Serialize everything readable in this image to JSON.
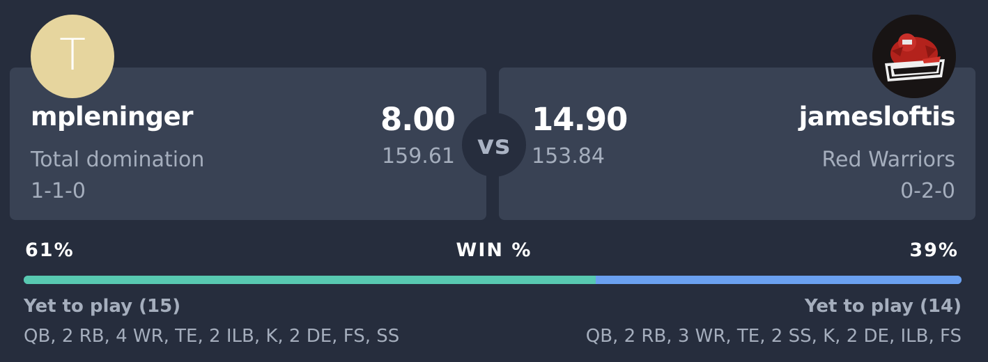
{
  "matchup": {
    "home": {
      "avatar_initial": "T",
      "avatar_color": "#e6d59e",
      "owner": "mpleninger",
      "team_name": "Total domination",
      "record": "1-1-0",
      "score": "8.00",
      "projected": "159.61",
      "win_pct": "61%",
      "win_fraction": 0.61,
      "yet_to_play": "Yet to play (15)",
      "positions": "QB, 2 RB, 4 WR, TE, 2 ILB, K, 2 DE, FS, SS"
    },
    "away": {
      "logo_icon": "red-warriors-logo-icon",
      "owner": "jamesloftis",
      "team_name": "Red Warriors",
      "record": "0-2-0",
      "score": "14.90",
      "projected": "153.84",
      "win_pct": "39%",
      "yet_to_play": "Yet to play (14)",
      "positions": "QB, 2 RB, 3 WR, TE, 2 SS, K, 2 DE, ILB, FS"
    },
    "vs_label": "vs",
    "win_label": "WIN %"
  },
  "colors": {
    "background": "#262d3d",
    "card": "#394254",
    "home_bar": "#58c9b1",
    "away_bar": "#6aa0f0"
  }
}
